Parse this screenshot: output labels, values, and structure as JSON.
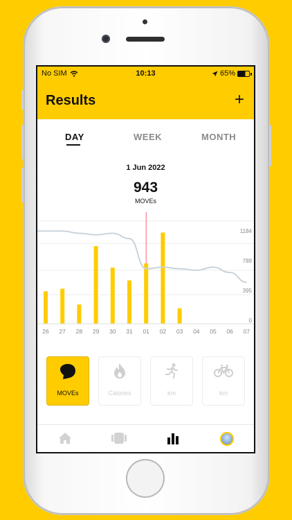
{
  "status": {
    "carrier": "No SIM",
    "time": "10:13",
    "battery": "65%"
  },
  "header": {
    "title": "Results",
    "add_label": "+"
  },
  "tabs": [
    {
      "label": "DAY",
      "active": true
    },
    {
      "label": "WEEK",
      "active": false
    },
    {
      "label": "MONTH",
      "active": false
    }
  ],
  "summary": {
    "date": "1 Jun 2022",
    "value": "943",
    "unit": "MOVEs"
  },
  "chart_data": {
    "type": "bar",
    "categories": [
      "26",
      "27",
      "28",
      "29",
      "30",
      "31",
      "01",
      "02",
      "03",
      "04",
      "05",
      "06",
      "07"
    ],
    "values": [
      430,
      465,
      255,
      1030,
      745,
      575,
      800,
      1210,
      205,
      0,
      0,
      0,
      0
    ],
    "trend": [
      1230,
      1230,
      1200,
      1180,
      1200,
      1130,
      730,
      750,
      730,
      710,
      750,
      680,
      550
    ],
    "y_ticks": [
      0,
      395,
      789,
      1184
    ],
    "ylim": [
      0,
      1480
    ],
    "selected_index": 6,
    "colors": {
      "bar": "#FFCC00",
      "trend": "#c9d3dc",
      "marker": "#ff5c7a",
      "grid": "#eeeeee"
    }
  },
  "cards": [
    {
      "label": "MOVEs",
      "icon": "moves-icon",
      "active": true
    },
    {
      "label": "Calories",
      "icon": "flame-icon",
      "active": false
    },
    {
      "label": "km",
      "icon": "running-icon",
      "active": false
    },
    {
      "label": "km",
      "icon": "bicycle-icon",
      "active": false
    }
  ],
  "tabbar": [
    {
      "icon": "home-icon",
      "active": false
    },
    {
      "icon": "wearable-icon",
      "active": false
    },
    {
      "icon": "stats-icon",
      "active": true
    },
    {
      "icon": "profile-icon",
      "active": false
    }
  ]
}
